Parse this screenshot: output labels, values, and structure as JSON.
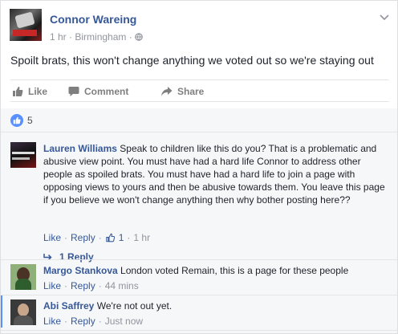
{
  "post": {
    "author": "Connor Wareing",
    "time": "1 hr",
    "location": "Birmingham",
    "meta_sep": "·",
    "privacy_icon": "globe-icon",
    "text": "Spoilt brats, this won't change anything we voted out so we're staying out"
  },
  "actions": {
    "like": "Like",
    "comment": "Comment",
    "share": "Share"
  },
  "likes": {
    "count": "5"
  },
  "comments": [
    {
      "name": "Lauren Williams",
      "text": "Speak to children like this do you? That is a problematic and abusive view point. You must have had a hard life Connor to address other people as spoiled brats. You must have had a hard life to join a page with opposing views to yours and then be abusive towards them. You leave this page if you believe we won't change anything then why bother posting here??",
      "like": "Like",
      "reply": "Reply",
      "reaction_count": "1",
      "time": "1 hr",
      "replies_label": "1 Reply"
    },
    {
      "name": "Margo Stankova",
      "text": "London voted Remain, this is a page for these people",
      "like": "Like",
      "reply": "Reply",
      "time": "44 mins"
    },
    {
      "name": "Abi Saffrey",
      "text": "We're not out yet.",
      "like": "Like",
      "reply": "Reply",
      "time": "Just now"
    }
  ],
  "colors": {
    "link": "#365899",
    "muted": "#90949c",
    "accent": "#5890ff"
  }
}
